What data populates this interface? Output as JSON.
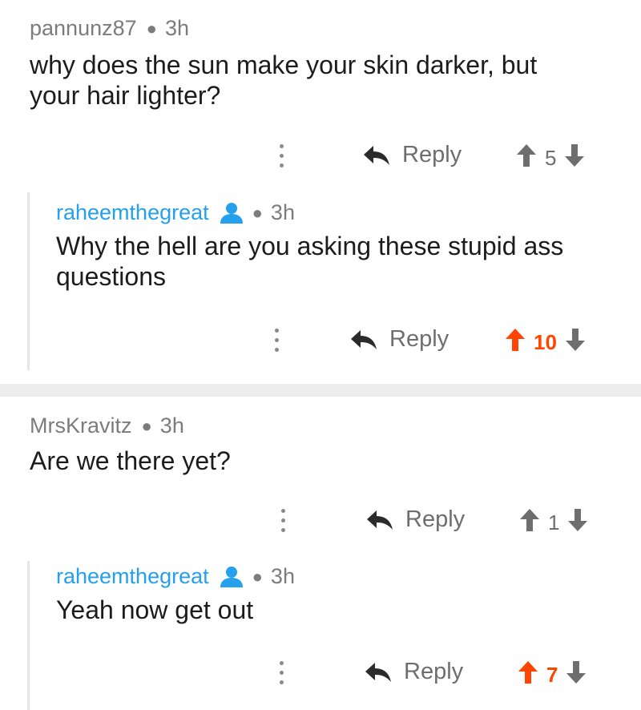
{
  "reply_label": "Reply",
  "colors": {
    "op_blue": "#24a0ed",
    "upvote_orange": "#ff4500",
    "muted_gray": "#7c7c7c"
  },
  "threads": [
    {
      "comment": {
        "author": "pannunz87",
        "age": "3h",
        "text_lines": [
          "why does the sun make your skin darker, but",
          "your hair lighter?"
        ],
        "score": "5",
        "upvoted": false
      },
      "reply": {
        "author": "raheemthegreat",
        "age": "3h",
        "text_lines": [
          "Why the hell are you asking these stupid ass",
          "questions"
        ],
        "score": "10",
        "upvoted": true
      }
    },
    {
      "comment": {
        "author": "MrsKravitz",
        "age": "3h",
        "text_lines": [
          "Are we there yet?"
        ],
        "score": "1",
        "upvoted": false
      },
      "reply": {
        "author": "raheemthegreat",
        "age": "3h",
        "text_lines": [
          "Yeah now get out"
        ],
        "score": "7",
        "upvoted": true
      }
    }
  ]
}
